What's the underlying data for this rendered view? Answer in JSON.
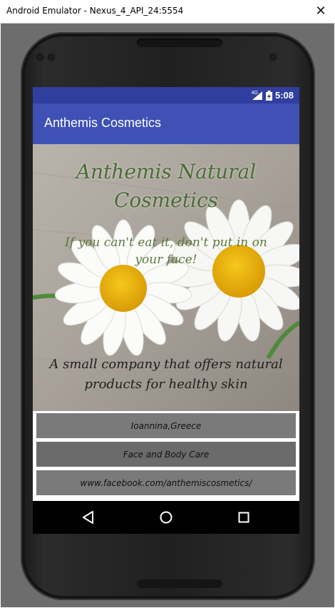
{
  "window": {
    "title": "Android Emulator - Nexus_4_API_24:5554",
    "close_glyph": "✕"
  },
  "statusbar": {
    "network": "4G",
    "time": "5:08",
    "icons": [
      "signal-icon",
      "battery-icon"
    ]
  },
  "appbar": {
    "title": "Anthemis Cosmetics"
  },
  "hero": {
    "heading_line1": "Anthemis Natural",
    "heading_line2": "Cosmetics",
    "tagline_line1": "If you can't eat it, don't put in on",
    "tagline_line2": "your face!",
    "sub_line1": "A small company that offers natural",
    "sub_line2": "products for  healthy skin"
  },
  "buttons": [
    {
      "label": "Ioannina,Greece",
      "color": "#7a7a7a"
    },
    {
      "label": "Face and Body Care",
      "color": "#6b6b6b"
    },
    {
      "label": "www.facebook.com/anthemiscosmetics/",
      "color": "#7a7a7a"
    }
  ],
  "navbar": {
    "icons": [
      "back-icon",
      "home-icon",
      "recents-icon"
    ]
  },
  "colors": {
    "statusbar": "#303f9f",
    "appbar": "#3f51b5",
    "heading": "#4a6b36"
  }
}
